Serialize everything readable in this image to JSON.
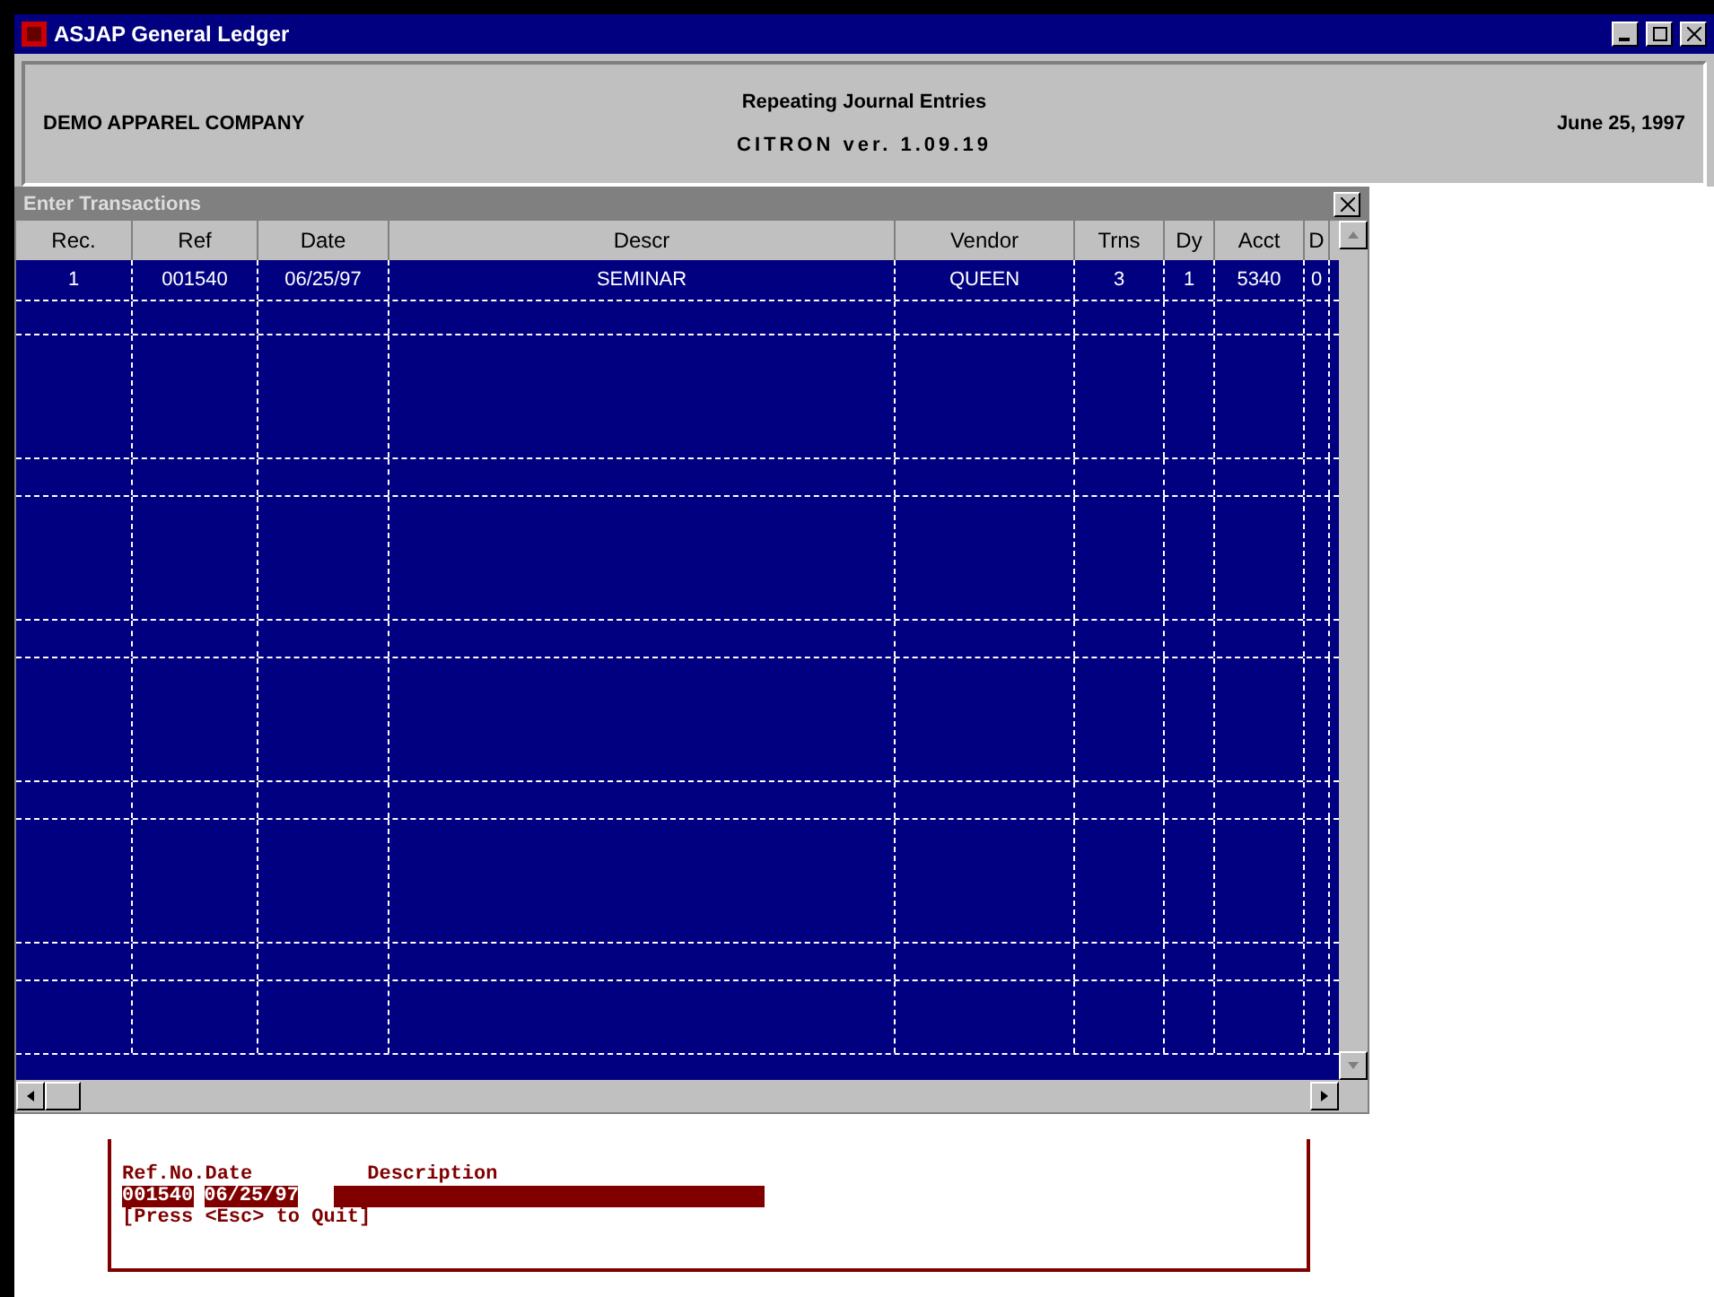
{
  "window": {
    "title": "ASJAP  General Ledger"
  },
  "header": {
    "company": "DEMO APPAREL COMPANY",
    "heading": "Repeating Journal Entries",
    "version": "CITRON ver. 1.09.19",
    "date": "June 25, 1997"
  },
  "child_window": {
    "title": "Enter Transactions"
  },
  "table": {
    "columns": [
      "Rec.",
      "Ref",
      "Date",
      "Descr",
      "Vendor",
      "Trns",
      "Dy",
      "Acct",
      "D"
    ],
    "rows": [
      {
        "selected": true,
        "cells": [
          "1",
          "001540",
          "06/25/97",
          "SEMINAR",
          "QUEEN",
          "3",
          "1",
          "5340",
          "0"
        ]
      }
    ]
  },
  "form": {
    "labels": [
      "Ref.No.",
      "Date",
      "Description"
    ],
    "values": [
      "001540",
      "06/25/97"
    ],
    "hint": "[Press <Esc> to Quit]"
  }
}
